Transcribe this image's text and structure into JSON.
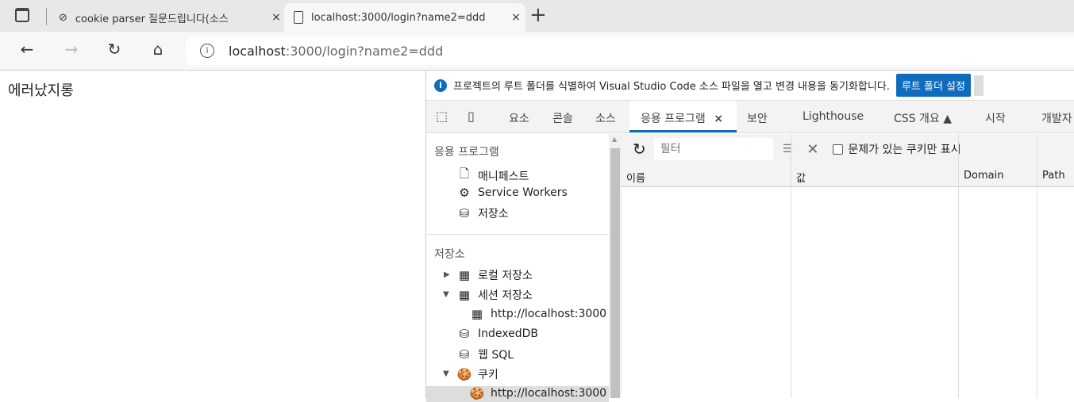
{
  "browser": {
    "tabs": [
      {
        "title": "cookie parser 질문드립니다(소스",
        "icon": "search-history-icon"
      },
      {
        "title": "localhost:3000/login?name2=ddd",
        "icon": "page-icon"
      }
    ],
    "close": "×",
    "new_tab": "+",
    "url_host": "localhost",
    "url_rest": ":3000/login?name2=ddd"
  },
  "page": {
    "text": "에러났지롱"
  },
  "devtools": {
    "info": {
      "icon": "i",
      "message": "프로젝트의 루트 폴더를 식별하여 Visual Studio Code 소스 파일을 열고 변경 내용을 동기화합니다.",
      "button": "루트 폴더 설정"
    },
    "tabs": [
      "요소",
      "콘솔",
      "소스",
      "응용 프로그램",
      "보안",
      "Lighthouse",
      "CSS 개요 ▲",
      "시작",
      "개발자"
    ],
    "tab_close": "×",
    "sidebar": {
      "app_header": "응용 프로그램",
      "app_items": [
        "매니페스트",
        "Service Workers",
        "저장소"
      ],
      "storage_header": "저장소",
      "storage_items": [
        "로컬 저장소",
        "세션 저장소",
        "http://localhost:3000",
        "IndexedDB",
        "웹 SQL",
        "쿠키",
        "http://localhost:3000"
      ]
    },
    "cookies": {
      "filter_placeholder": "필터",
      "only_issues_label": "문제가 있는 쿠키만 표시",
      "columns": [
        "이름",
        "값",
        "Domain",
        "Path"
      ]
    }
  }
}
